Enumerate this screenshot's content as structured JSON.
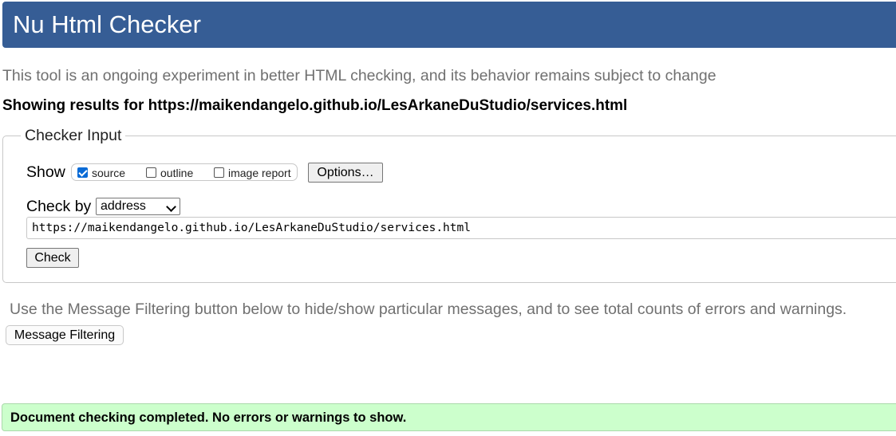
{
  "header": {
    "title": "Nu Html Checker"
  },
  "tagline": "This tool is an ongoing experiment in better HTML checking, and its behavior remains subject to change",
  "results_heading": "Showing results for https://maikendangelo.github.io/LesArkaneDuStudio/services.html",
  "checker_input": {
    "legend": "Checker Input",
    "show_label": "Show",
    "show_options": [
      {
        "label": "source",
        "checked": true
      },
      {
        "label": "outline",
        "checked": false
      },
      {
        "label": "image report",
        "checked": false
      }
    ],
    "options_button": "Options…",
    "check_by_label": "Check by",
    "check_by_selected": "address",
    "url_value": "https://maikendangelo.github.io/LesArkaneDuStudio/services.html",
    "check_button": "Check"
  },
  "filter_note": "Use the Message Filtering button below to hide/show particular messages, and to see total counts of errors and warnings.",
  "filter_button": "Message Filtering",
  "status": {
    "message": "Document checking completed. No errors or warnings to show.",
    "color": "#ccffcc"
  },
  "colors": {
    "header_bg": "#365d95",
    "checkbox_accent": "#0a6bd6"
  }
}
